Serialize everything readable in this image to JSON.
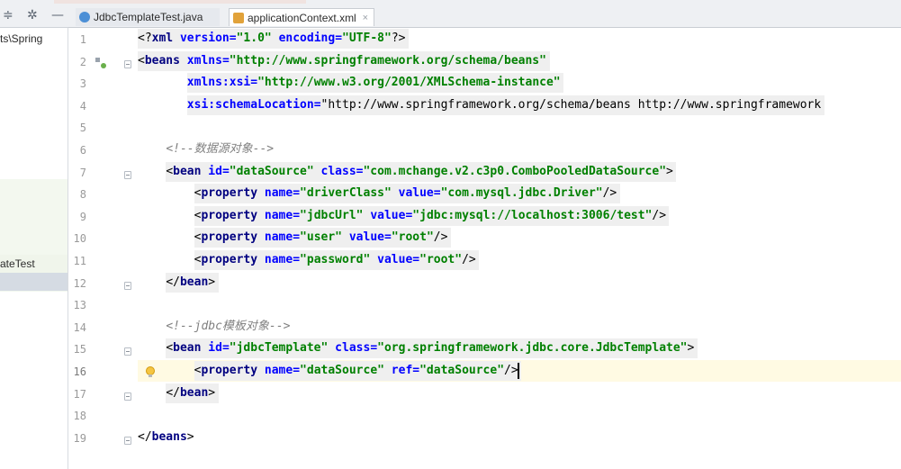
{
  "tabs": [
    {
      "label": "JdbcTemplateTest.java",
      "icon": "java-class-icon",
      "active": false
    },
    {
      "label": "applicationContext.xml",
      "icon": "xml-file-icon",
      "active": true,
      "close": "×"
    }
  ],
  "project_panel": {
    "path_fragment": "ts\\Spring",
    "selected_item": "ateTest"
  },
  "tool_icons": [
    "equalize-icon",
    "gear-icon",
    "minimize-icon"
  ],
  "tool_glyphs": [
    "≑",
    "✲",
    "—"
  ],
  "editor": {
    "line_numbers": [
      "1",
      "2",
      "3",
      "4",
      "5",
      "6",
      "7",
      "8",
      "9",
      "10",
      "11",
      "12",
      "13",
      "14",
      "15",
      "16",
      "17",
      "18",
      "19"
    ],
    "current_line": "16",
    "lines": [
      "<?xml version=\"1.0\" encoding=\"UTF-8\"?>",
      "<beans xmlns=\"http://www.springframework.org/schema/beans\"",
      "       xmlns:xsi=\"http://www.w3.org/2001/XMLSchema-instance\"",
      "       xsi:schemaLocation=\"http://www.springframework.org/schema/beans http://www.springframework",
      "",
      "    <!--数据源对象-->",
      "    <bean id=\"dataSource\" class=\"com.mchange.v2.c3p0.ComboPooledDataSource\">",
      "        <property name=\"driverClass\" value=\"com.mysql.jdbc.Driver\"/>",
      "        <property name=\"jdbcUrl\" value=\"jdbc:mysql://localhost:3006/test\"/>",
      "        <property name=\"user\" value=\"root\"/>",
      "        <property name=\"password\" value=\"root\"/>",
      "    </bean>",
      "",
      "    <!--jdbc模板对象-->",
      "    <bean id=\"jdbcTemplate\" class=\"org.springframework.jdbc.core.JdbcTemplate\">",
      "        <property name=\"dataSource\" ref=\"dataSource\"/>",
      "    </bean>",
      "",
      "</beans>"
    ]
  },
  "colors": {
    "tag": "#000080",
    "attribute": "#0000ff",
    "value": "#008000",
    "comment": "#808080",
    "current_line_bg": "#fffae3"
  }
}
